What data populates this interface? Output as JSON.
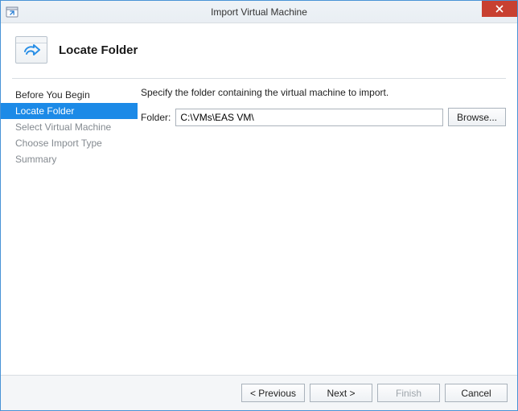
{
  "window": {
    "title": "Import Virtual Machine",
    "page_heading": "Locate Folder"
  },
  "nav": {
    "items": [
      {
        "label": "Before You Begin"
      },
      {
        "label": "Locate Folder"
      },
      {
        "label": "Select Virtual Machine"
      },
      {
        "label": "Choose Import Type"
      },
      {
        "label": "Summary"
      }
    ]
  },
  "content": {
    "instruction": "Specify the folder containing the virtual machine to import.",
    "folder_label": "Folder:",
    "folder_value": "C:\\VMs\\EAS VM\\",
    "browse_label": "Browse..."
  },
  "footer": {
    "previous": "< Previous",
    "next": "Next >",
    "finish": "Finish",
    "cancel": "Cancel"
  }
}
